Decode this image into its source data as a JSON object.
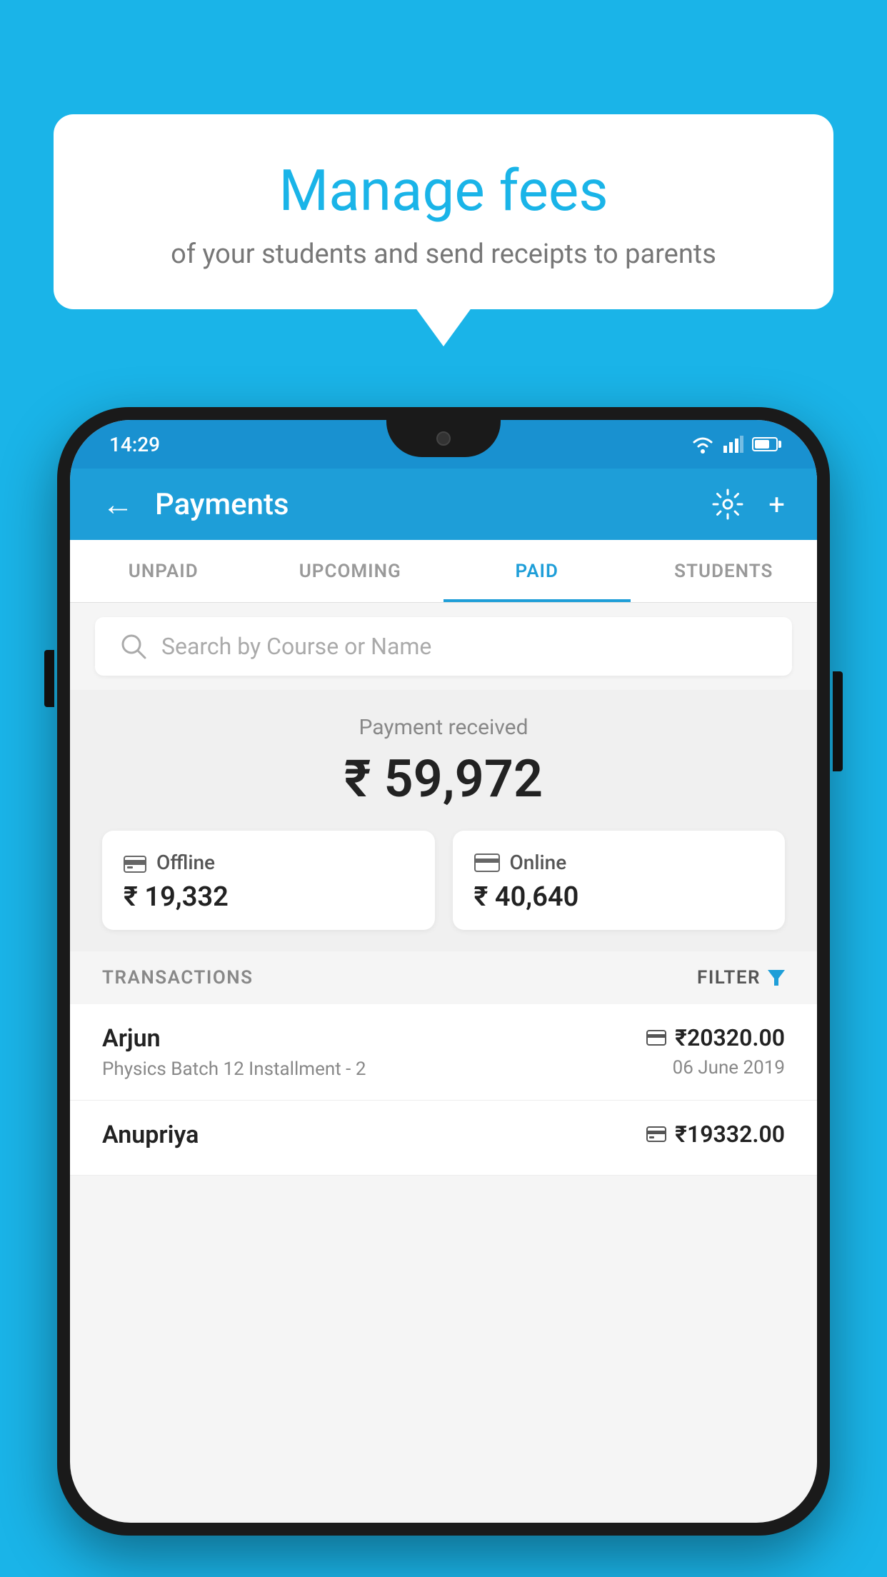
{
  "background_color": "#1ab4e8",
  "speech_bubble": {
    "title": "Manage fees",
    "subtitle": "of your students and send receipts to parents"
  },
  "status_bar": {
    "time": "14:29"
  },
  "header": {
    "title": "Payments",
    "back_label": "←",
    "settings_label": "⚙",
    "add_label": "+"
  },
  "tabs": [
    {
      "label": "UNPAID",
      "active": false
    },
    {
      "label": "UPCOMING",
      "active": false
    },
    {
      "label": "PAID",
      "active": true
    },
    {
      "label": "STUDENTS",
      "active": false
    }
  ],
  "search": {
    "placeholder": "Search by Course or Name"
  },
  "payment_summary": {
    "received_label": "Payment received",
    "total_amount": "₹ 59,972",
    "offline_label": "Offline",
    "offline_amount": "₹ 19,332",
    "online_label": "Online",
    "online_amount": "₹ 40,640"
  },
  "transactions": {
    "header_label": "TRANSACTIONS",
    "filter_label": "FILTER",
    "rows": [
      {
        "name": "Arjun",
        "details": "Physics Batch 12 Installment - 2",
        "amount": "₹20320.00",
        "date": "06 June 2019",
        "payment_type": "card"
      },
      {
        "name": "Anupriya",
        "details": "",
        "amount": "₹19332.00",
        "date": "",
        "payment_type": "offline"
      }
    ]
  }
}
